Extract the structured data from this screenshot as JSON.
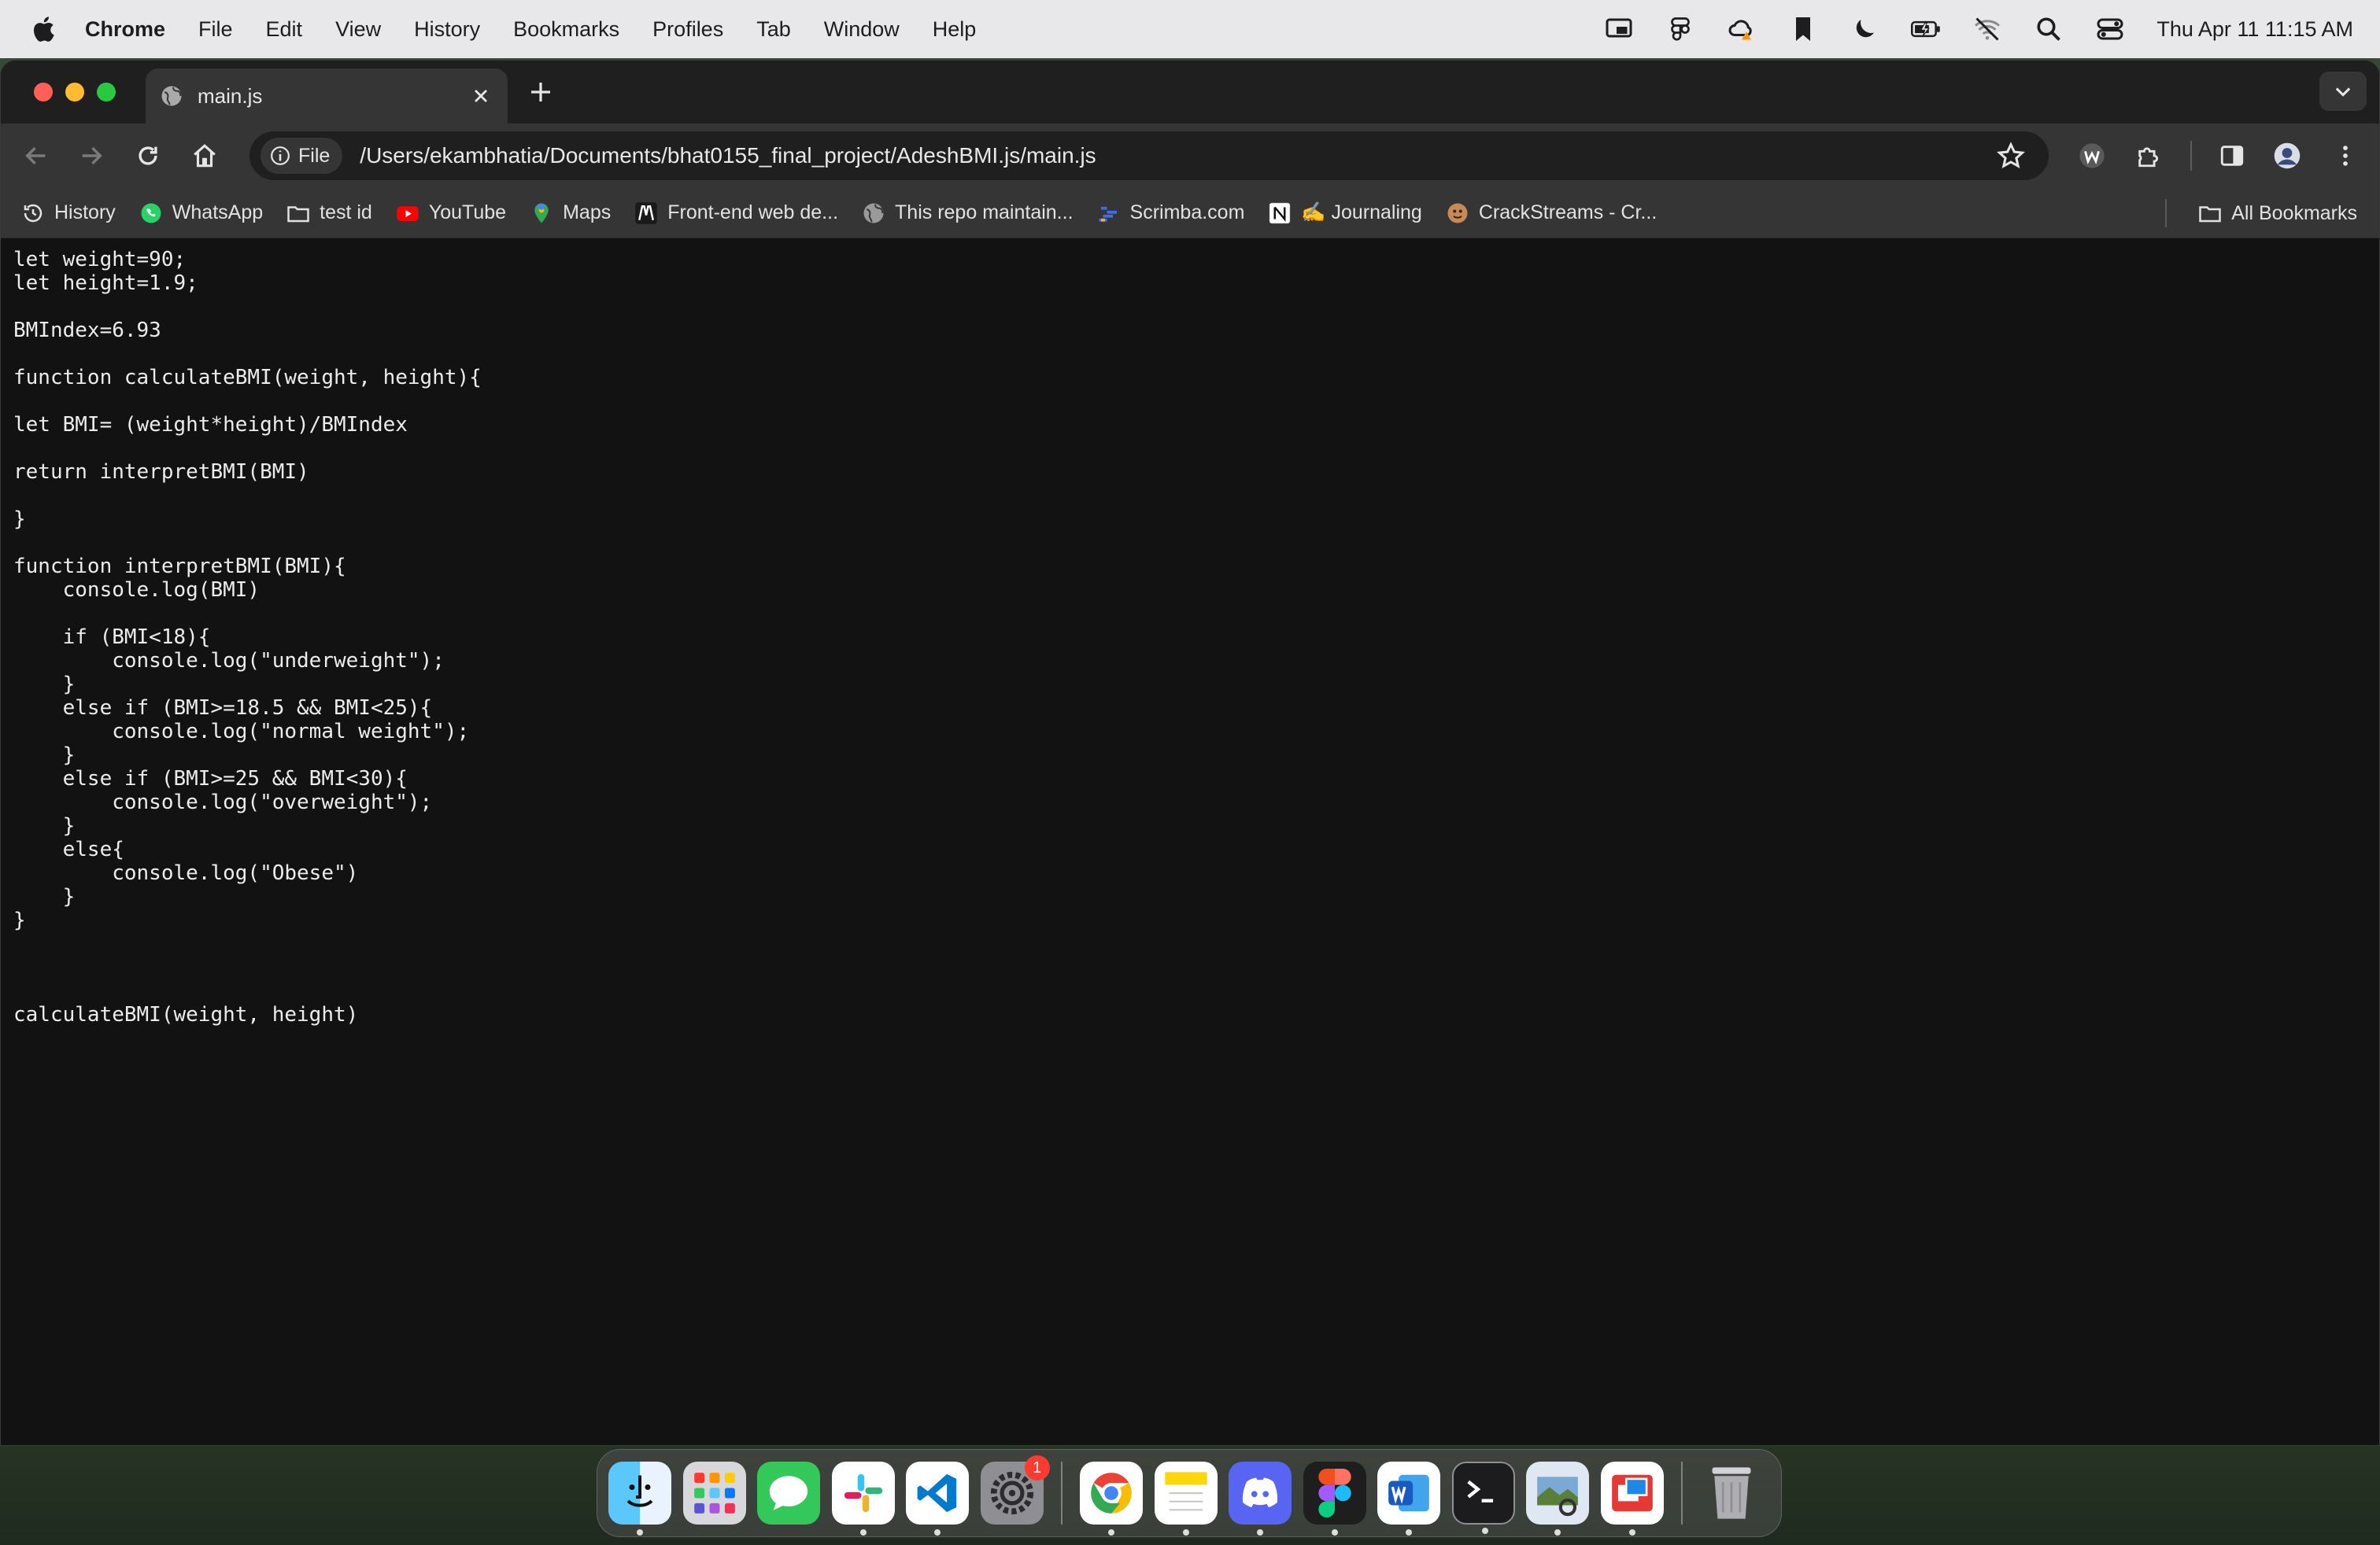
{
  "menubar": {
    "app_name": "Chrome",
    "items": [
      "File",
      "Edit",
      "View",
      "History",
      "Bookmarks",
      "Profiles",
      "Tab",
      "Window",
      "Help"
    ],
    "status_icons": [
      "screen-mirroring-icon",
      "figma-icon",
      "creative-cloud-icon",
      "bookmark-icon",
      "moon-icon",
      "battery-icon",
      "wifi-off-icon",
      "search-icon",
      "control-center-icon"
    ],
    "clock": "Thu Apr 11  11:15 AM"
  },
  "browser": {
    "tab_title": "main.js",
    "omnibox_chip": "File",
    "url": "/Users/ekambhatia/Documents/bhat0155_final_project/AdeshBMI.js/main.js"
  },
  "bookmarks": [
    {
      "label": "History",
      "icon": "history-icon"
    },
    {
      "label": "WhatsApp",
      "icon": "whatsapp-icon"
    },
    {
      "label": "test id",
      "icon": "folder-icon"
    },
    {
      "label": "YouTube",
      "icon": "youtube-icon"
    },
    {
      "label": "Maps",
      "icon": "maps-icon"
    },
    {
      "label": "Front-end web de...",
      "icon": "m-logo-icon"
    },
    {
      "label": "This repo maintain...",
      "icon": "globe-icon"
    },
    {
      "label": "Scrimba.com",
      "icon": "scrimba-icon"
    },
    {
      "label": "✍️ Journaling",
      "icon": "notion-icon"
    },
    {
      "label": "CrackStreams - Cr...",
      "icon": "crackstreams-icon"
    }
  ],
  "all_bookmarks_label": "All Bookmarks",
  "code_lines": [
    "let weight=90;",
    "let height=1.9;",
    "",
    "BMIndex=6.93",
    "",
    "function calculateBMI(weight, height){",
    "",
    "let BMI= (weight*height)/BMIndex",
    "",
    "return interpretBMI(BMI)",
    "",
    "}",
    "",
    "function interpretBMI(BMI){",
    "    console.log(BMI)",
    "",
    "    if (BMI<18){",
    "        console.log(\"underweight\");",
    "    }",
    "    else if (BMI>=18.5 && BMI<25){",
    "        console.log(\"normal weight\");",
    "    }",
    "    else if (BMI>=25 && BMI<30){",
    "        console.log(\"overweight\");",
    "    }",
    "    else{",
    "        console.log(\"Obese\")",
    "    }",
    "}",
    "",
    "",
    "",
    "calculateBMI(weight, height)"
  ],
  "dock": {
    "apps": [
      "finder-icon",
      "launchpad-icon",
      "messages-icon",
      "slack-icon",
      "vscode-icon",
      "system-settings-icon",
      "chrome-icon",
      "notes-icon",
      "discord-icon",
      "figma-icon",
      "word-icon",
      "terminal-icon",
      "preview-icon",
      "screen-sharing-icon",
      "trash-icon"
    ],
    "settings_badge": "1"
  }
}
